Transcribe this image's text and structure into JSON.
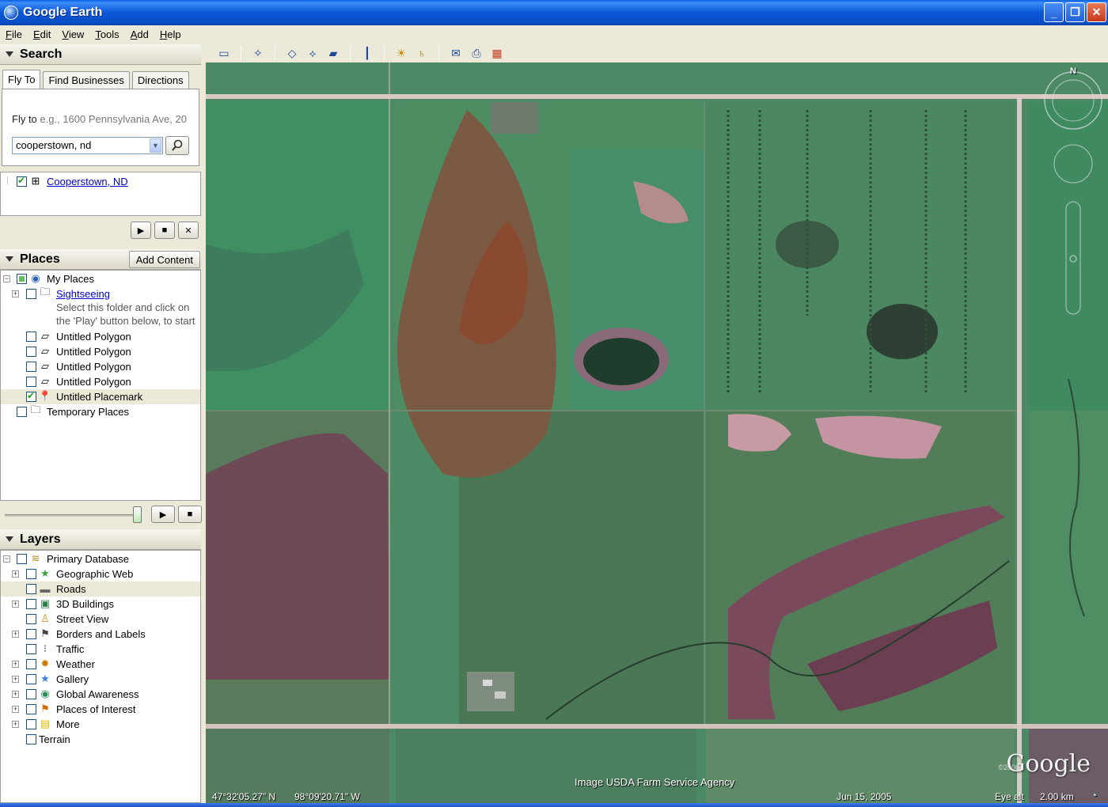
{
  "window": {
    "title": "Google Earth",
    "min": "_",
    "max": "❐",
    "close": "✕"
  },
  "menu": [
    "File",
    "Edit",
    "View",
    "Tools",
    "Add",
    "Help"
  ],
  "search": {
    "header": "Search",
    "tabs": [
      "Fly To",
      "Find Businesses",
      "Directions"
    ],
    "flyto_label": "Fly to",
    "flyto_hint": " e.g., 1600 Pennsylvania Ave, 20",
    "query": "cooperstown, nd",
    "result": "Cooperstown, ND"
  },
  "places": {
    "header": "Places",
    "add_content": "Add Content",
    "items": {
      "my_places": "My Places",
      "sightseeing": "Sightseeing",
      "note1": "Select this folder and click on",
      "note2": "the 'Play' button below, to start",
      "poly1": "Untitled Polygon",
      "poly2": "Untitled Polygon",
      "poly3": "Untitled Polygon",
      "poly4": "Untitled Polygon",
      "placemark": "Untitled Placemark",
      "temp": "Temporary Places"
    }
  },
  "layers": {
    "header": "Layers",
    "items": [
      "Primary Database",
      "Geographic Web",
      "Roads",
      "3D Buildings",
      "Street View",
      "Borders and Labels",
      "Traffic",
      "Weather",
      "Gallery",
      "Global Awareness",
      "Places of Interest",
      "More",
      "Terrain"
    ]
  },
  "map": {
    "attribution": "Image USDA Farm Service Agency",
    "latitude": "47°32'05.27\" N",
    "longitude": "98°09'20.71\" W",
    "date": "Jun 15, 2005",
    "eye_alt_label": "Eye alt",
    "eye_alt_value": "2.00 km",
    "copyright": "©2008",
    "logo": "Google",
    "compass_n": "N"
  },
  "colors": {
    "titlebar": "#0b57d8",
    "link": "#0000cc",
    "check": "#21a121"
  }
}
